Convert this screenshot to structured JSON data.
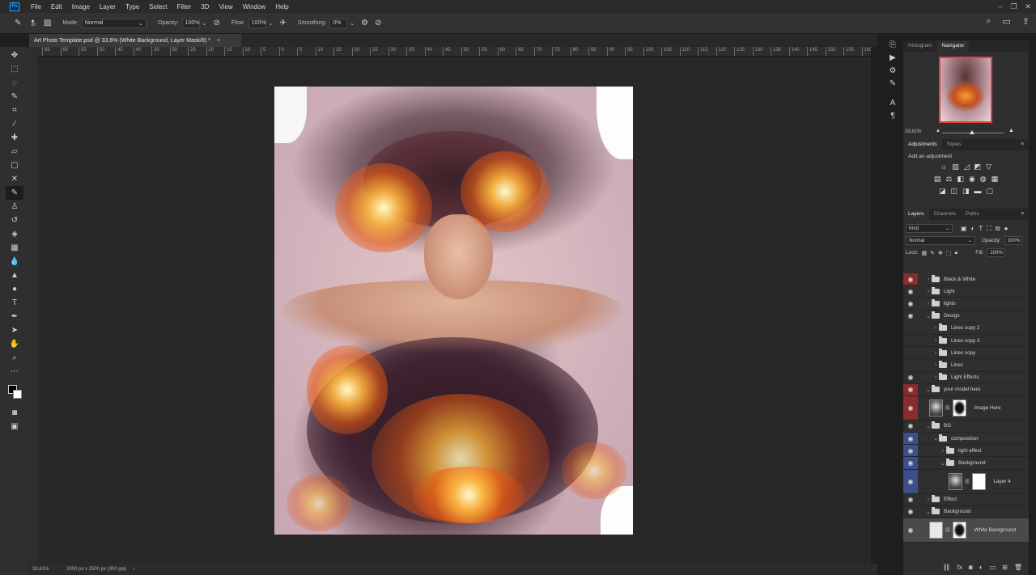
{
  "app": {
    "logo": "Ps"
  },
  "menu": [
    "File",
    "Edit",
    "Image",
    "Layer",
    "Type",
    "Select",
    "Filter",
    "3D",
    "View",
    "Window",
    "Help"
  ],
  "window_controls": [
    "–",
    "❐",
    "✕"
  ],
  "options_bar": {
    "brush_size": "20",
    "mode_label": "Mode:",
    "mode_value": "Normal",
    "opacity_label": "Opacity:",
    "opacity_value": "100%",
    "flow_label": "Flow:",
    "flow_value": "100%",
    "smoothing_label": "Smoothing:",
    "smoothing_value": "0%"
  },
  "document": {
    "tab_title": "Art Photo Template.psd @ 33,6% (White Background, Layer Mask/8) *",
    "close": "×"
  },
  "ruler_labels": [
    "65",
    "60",
    "55",
    "50",
    "45",
    "40",
    "35",
    "30",
    "25",
    "20",
    "15",
    "10",
    "5",
    "0",
    "5",
    "10",
    "15",
    "20",
    "25",
    "30",
    "35",
    "40",
    "45",
    "50",
    "55",
    "60",
    "65",
    "70",
    "75",
    "80",
    "85",
    "90",
    "95",
    "100",
    "105",
    "110",
    "115",
    "120",
    "125",
    "130",
    "135",
    "140",
    "145",
    "150",
    "155",
    "160"
  ],
  "status": {
    "zoom": "33,61%",
    "doc_info": "2000 px x 2500 px (300 ppi)",
    "arrow": "›"
  },
  "panels": {
    "top_tabs": [
      "Histogram",
      "Navigator"
    ],
    "navigator": {
      "zoom": "33,61%"
    },
    "adj_tabs": [
      "Adjustments",
      "Styles"
    ],
    "adj_title": "Add an adjustment",
    "layers_tabs": [
      "Layers",
      "Channels",
      "Paths"
    ],
    "kind_label": "Kind",
    "blend_mode": "Normal",
    "opacity_label": "Opacity:",
    "opacity_value": "100%",
    "lock_label": "Lock:",
    "fill_label": "Fill:",
    "fill_value": "100%"
  },
  "layers": [
    {
      "name": "Black & White",
      "eye": "red",
      "indent": 1,
      "chev": "›"
    },
    {
      "name": "Light",
      "eye": "on",
      "indent": 1,
      "chev": "›"
    },
    {
      "name": "lights",
      "eye": "on",
      "indent": 1,
      "chev": "›"
    },
    {
      "name": "Design",
      "eye": "on",
      "indent": 1,
      "chev": "⌄"
    },
    {
      "name": "Lines copy 2",
      "eye": "off",
      "indent": 2,
      "chev": "›"
    },
    {
      "name": "Lines copy 3",
      "eye": "off",
      "indent": 2,
      "chev": "›"
    },
    {
      "name": "Lines copy",
      "eye": "off",
      "indent": 2,
      "chev": "›"
    },
    {
      "name": "Lines",
      "eye": "off",
      "indent": 2,
      "chev": "›"
    },
    {
      "name": "Light Effects",
      "eye": "on",
      "indent": 2,
      "chev": "›"
    },
    {
      "name": "your model here",
      "eye": "red",
      "indent": 1,
      "chev": "⌄"
    },
    {
      "name": "Image Here",
      "eye": "red",
      "type": "image"
    },
    {
      "name": "BG",
      "eye": "on",
      "indent": 1,
      "chev": "⌄"
    },
    {
      "name": "composition",
      "eye": "blue",
      "indent": 2,
      "chev": "⌄"
    },
    {
      "name": "light effect",
      "eye": "blue",
      "indent": 3,
      "chev": "›"
    },
    {
      "name": "Background",
      "eye": "blue",
      "indent": 3,
      "chev": "⌄"
    },
    {
      "name": "Layer 4",
      "eye": "blue",
      "type": "layer4"
    },
    {
      "name": "Effect",
      "eye": "on",
      "indent": 1,
      "chev": "›"
    },
    {
      "name": "Background",
      "eye": "on",
      "indent": 1,
      "chev": "⌄"
    },
    {
      "name": "White Background",
      "eye": "on",
      "type": "whitebg"
    }
  ]
}
